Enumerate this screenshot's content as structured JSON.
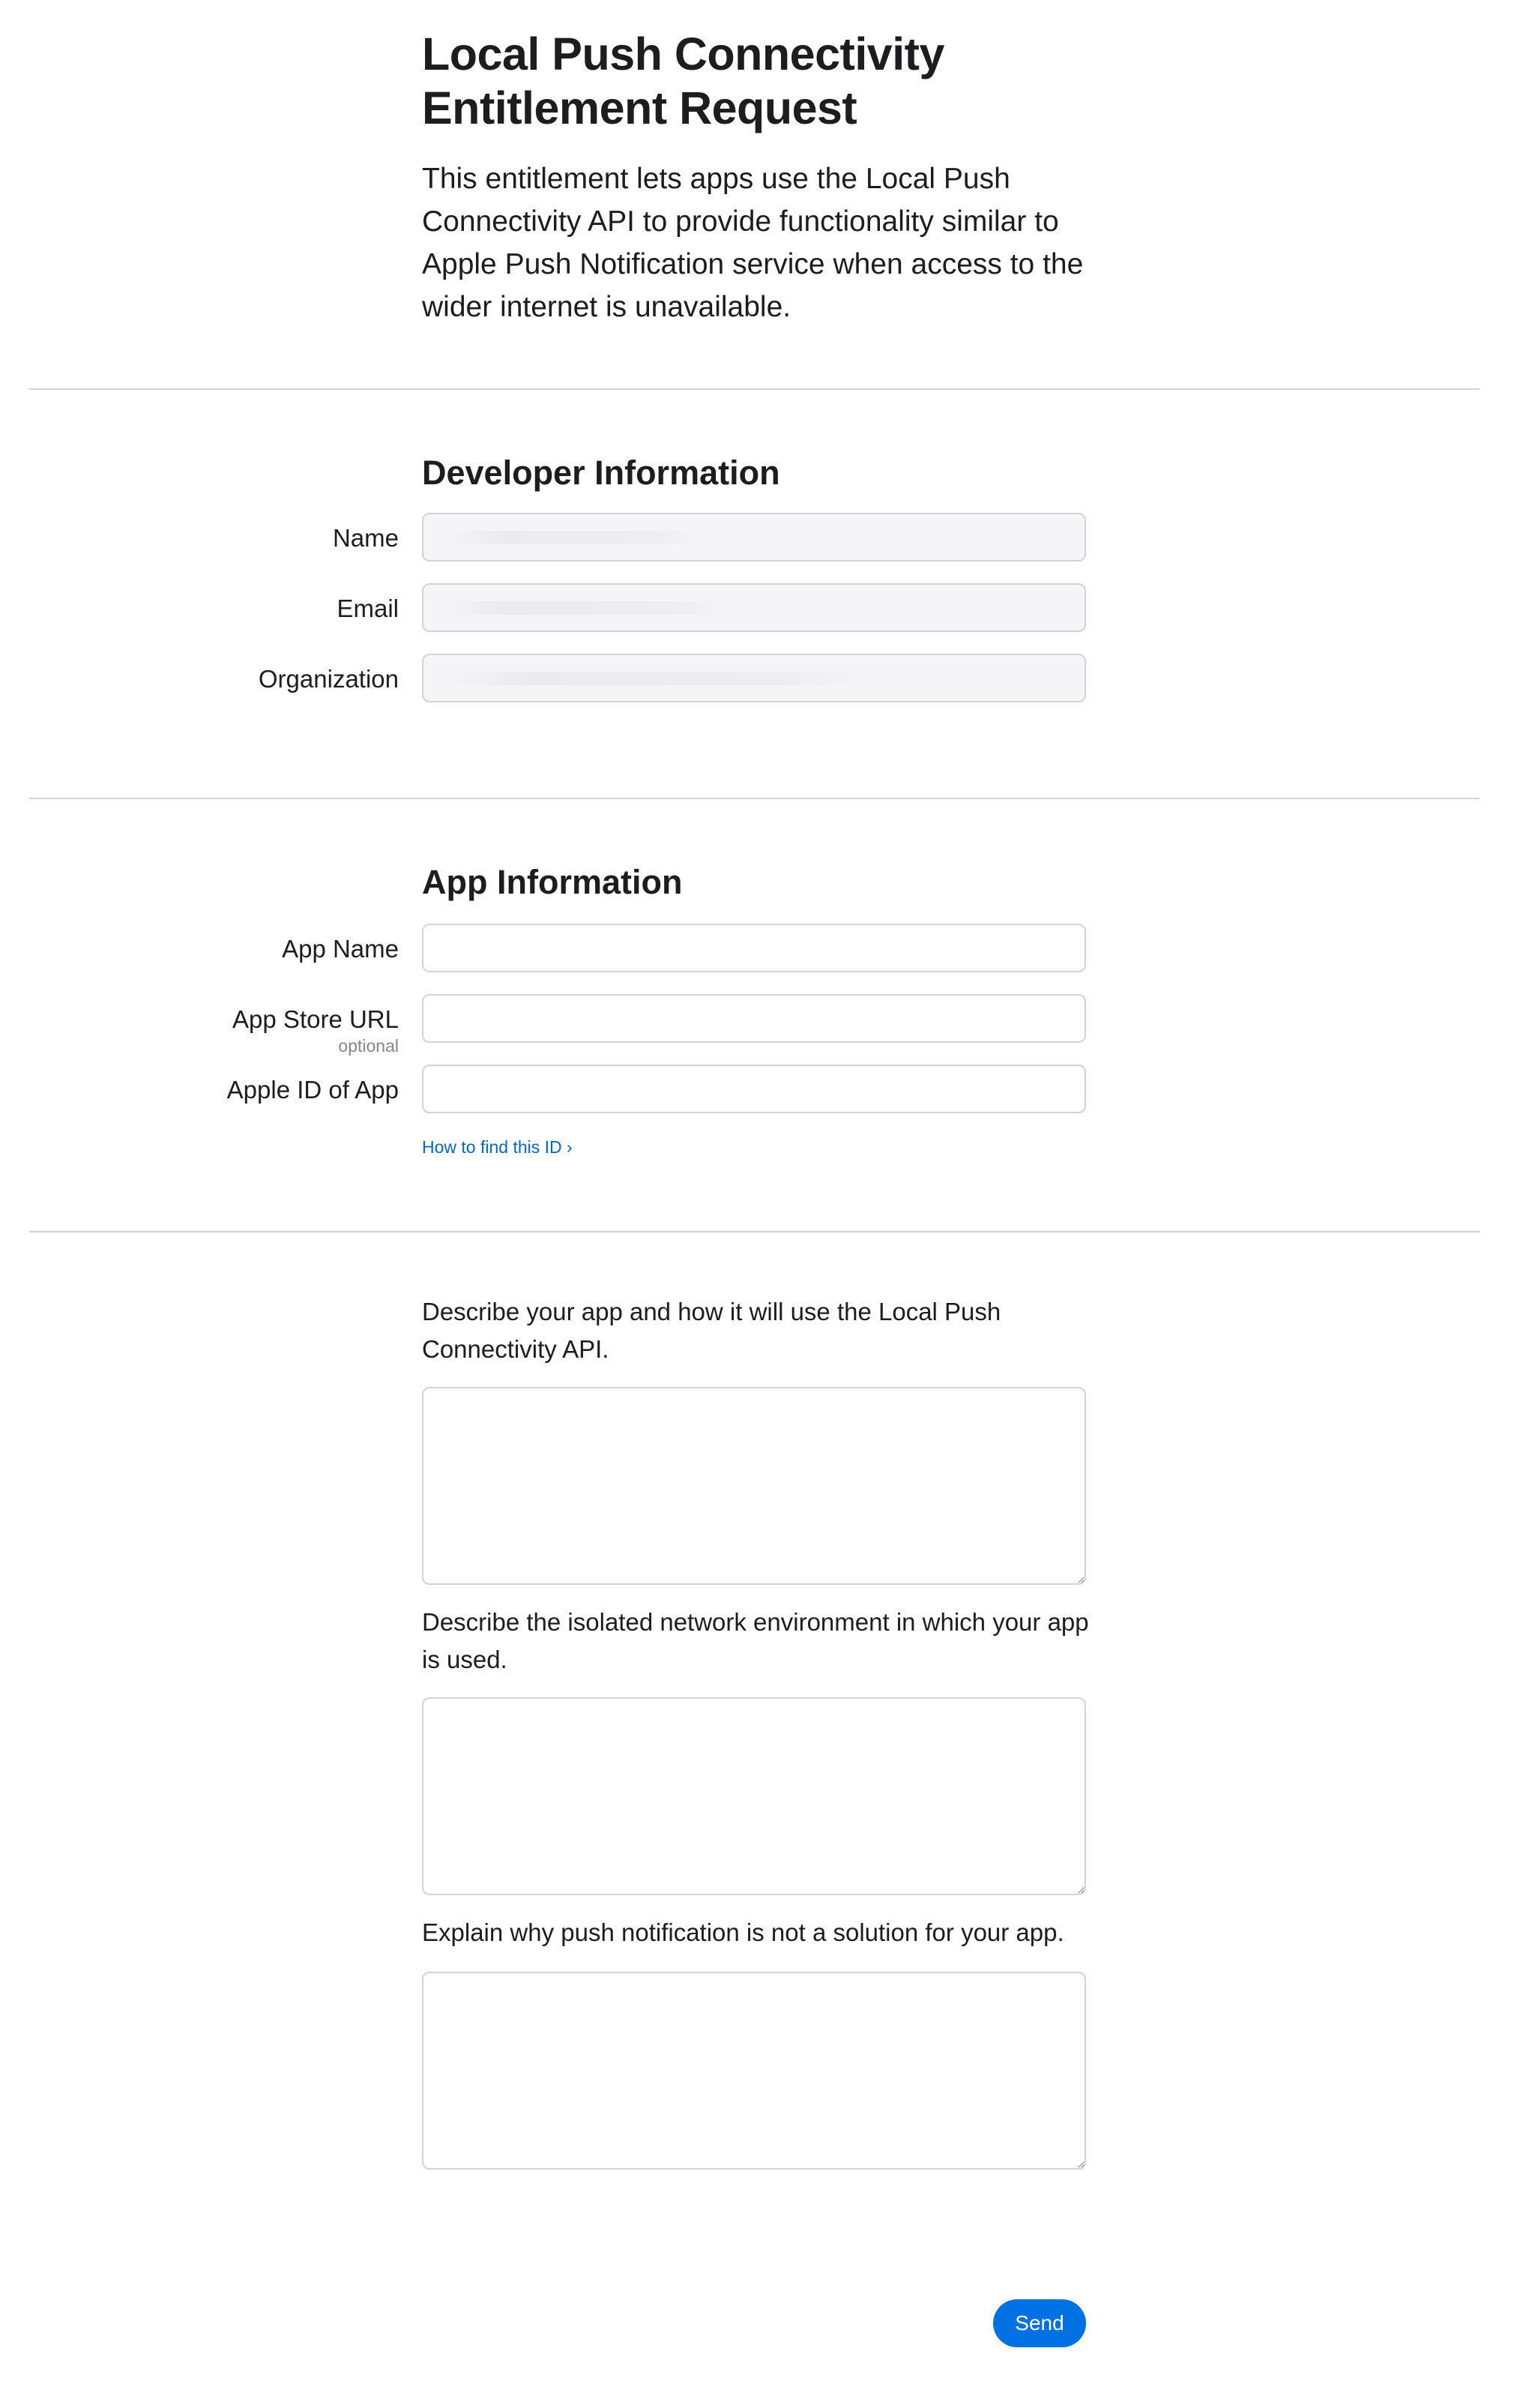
{
  "header": {
    "title_line1": "Local Push Connectivity",
    "title_line2": "Entitlement Request",
    "intro": "This entitlement lets apps use the Local Push Connectivity API to provide functionality similar to Apple Push Notification service when access to the wider internet is unavailable."
  },
  "developer_section": {
    "heading": "Developer Information",
    "fields": [
      {
        "label": "Name",
        "value": ""
      },
      {
        "label": "Email",
        "value": ""
      },
      {
        "label": "Organization",
        "value": ""
      }
    ]
  },
  "app_section": {
    "heading": "App Information",
    "fields": [
      {
        "label": "App Name",
        "value": ""
      },
      {
        "label": "App Store URL",
        "sublabel": "optional",
        "value": ""
      },
      {
        "label": "Apple ID of App",
        "value": ""
      }
    ],
    "help_link": "How to find this ID ›"
  },
  "questions_section": {
    "questions": [
      {
        "prompt": "Describe your app and how it will use the Local Push Connectivity API.",
        "value": ""
      },
      {
        "prompt": "Describe the isolated network environment in which your app is used.",
        "value": ""
      },
      {
        "prompt": "Explain why push notification is not a solution for your app.",
        "value": ""
      }
    ]
  },
  "actions": {
    "send_label": "Send"
  },
  "colors": {
    "accent": "#0071e3",
    "link": "#0066cc",
    "text": "#1d1d1f",
    "divider": "#d2d2d7",
    "readonly_field_bg": "#f5f5f7"
  }
}
